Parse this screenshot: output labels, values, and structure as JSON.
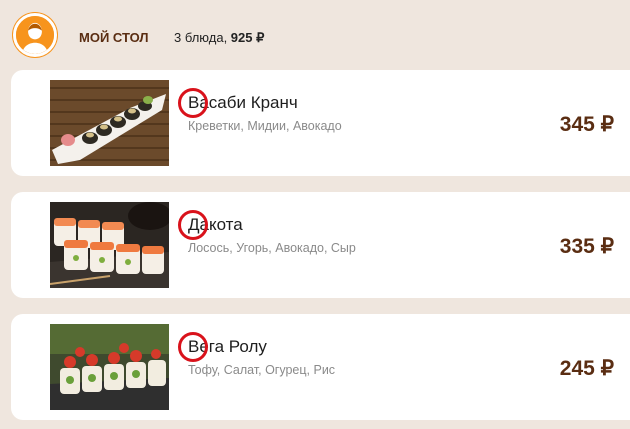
{
  "header": {
    "title": "МОЙ СТОЛ",
    "count_text": "3 блюда, ",
    "total": "925 ₽"
  },
  "items": [
    {
      "name": "Васаби Кранч",
      "ingredients": "Креветки, Мидии, Авокадо",
      "price": "345 ₽"
    },
    {
      "name": "Дакота",
      "ingredients": "Лосось, Угорь, Авокадо, Сыр",
      "price": "335 ₽"
    },
    {
      "name": "Вега Ролу",
      "ingredients": "Тофу, Салат, Огурец, Рис",
      "price": "245 ₽"
    }
  ],
  "colors": {
    "background": "#efe6de",
    "accent": "#f7941d",
    "title": "#5a2d12",
    "mark": "#d9121b"
  },
  "icons": {
    "avatar": "user-avatar-icon"
  }
}
